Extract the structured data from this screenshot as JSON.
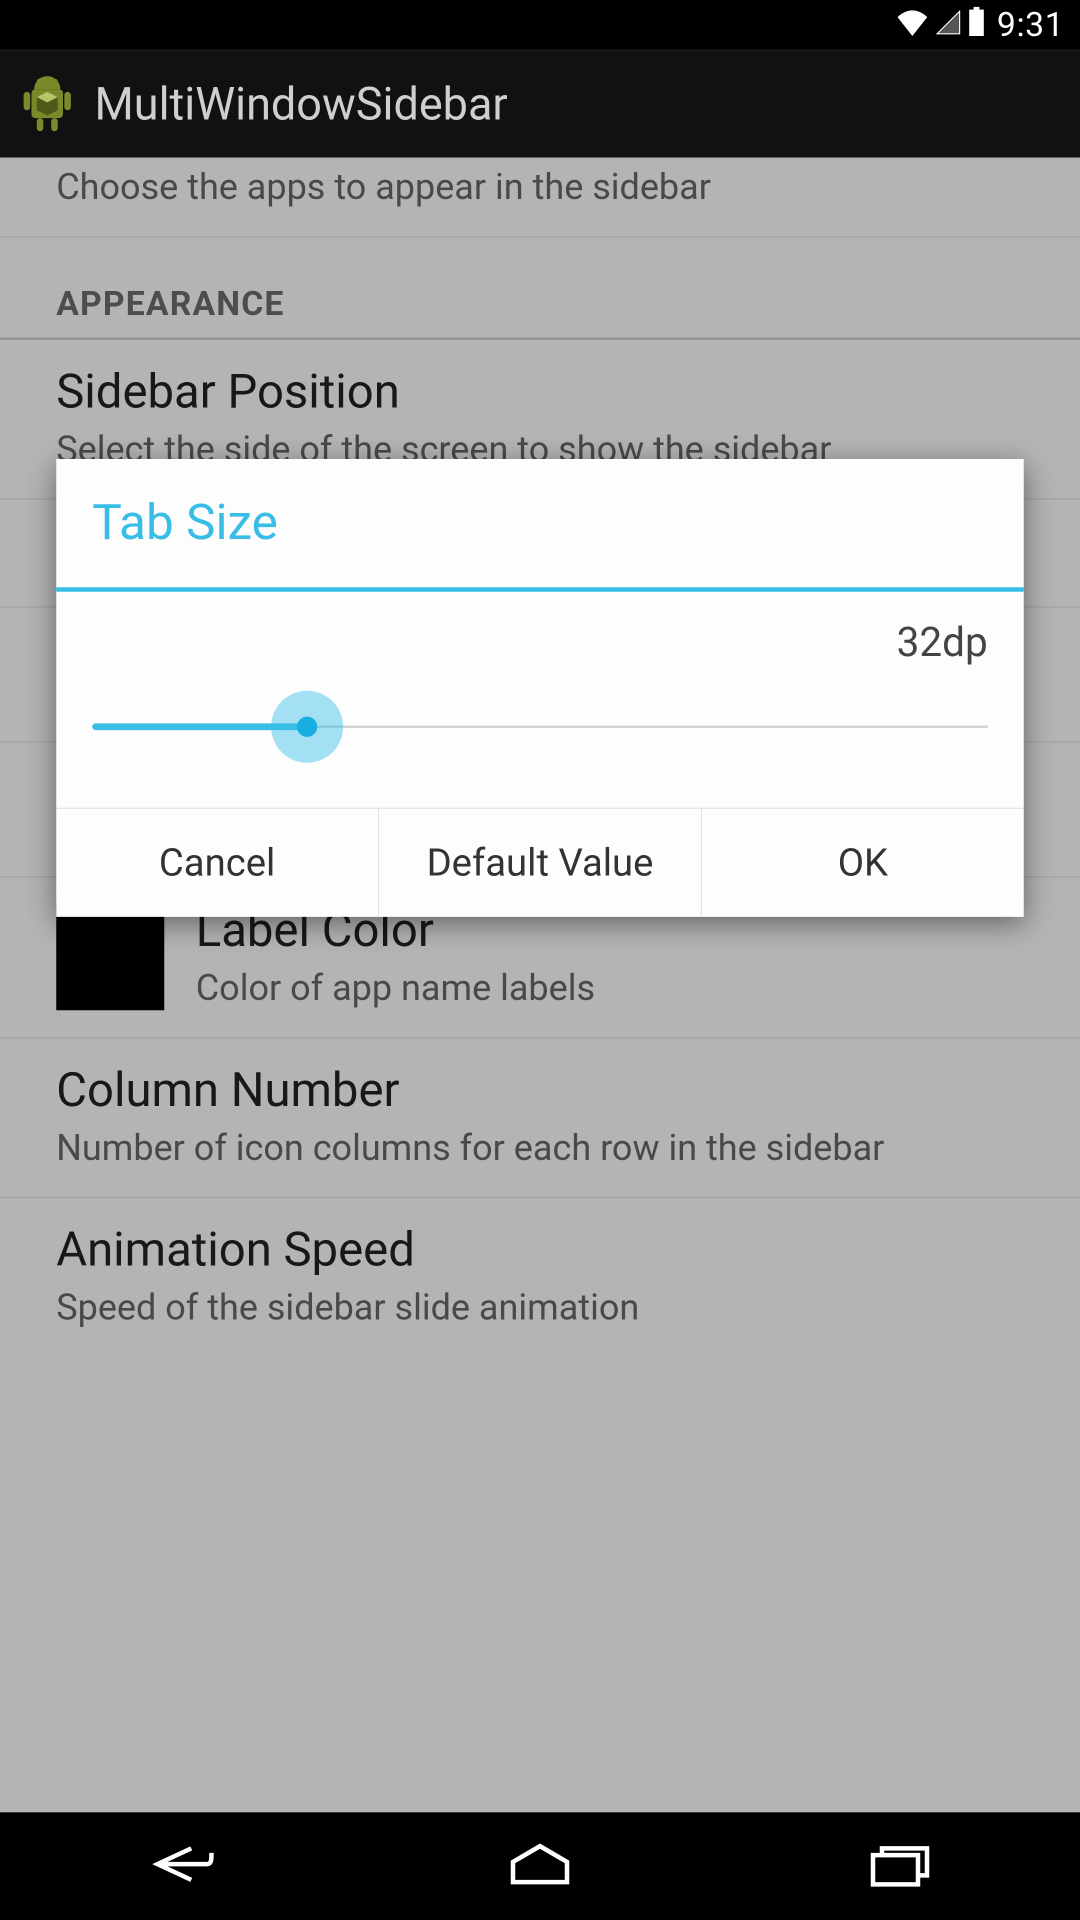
{
  "status": {
    "clock": "9:31"
  },
  "action_bar": {
    "title": "MultiWindowSidebar"
  },
  "settings": {
    "choose_apps_summary": "Choose the apps to appear in the sidebar",
    "section_appearance": "APPEARANCE",
    "sidebar_position": {
      "title": "Sidebar Position",
      "summary": "Select the side of the screen to show the sidebar"
    },
    "label_color": {
      "title": "Label Color",
      "summary": "Color of app name labels",
      "swatch_hex": "#000000"
    },
    "column_number": {
      "title": "Column Number",
      "summary": "Number of icon columns for each row in the sidebar"
    },
    "animation_speed": {
      "title": "Animation Speed",
      "summary": "Speed of the sidebar slide animation"
    }
  },
  "dialog": {
    "title": "Tab Size",
    "value_label": "32dp",
    "slider_percent": 24,
    "buttons": {
      "cancel": "Cancel",
      "default": "Default Value",
      "ok": "OK"
    }
  }
}
